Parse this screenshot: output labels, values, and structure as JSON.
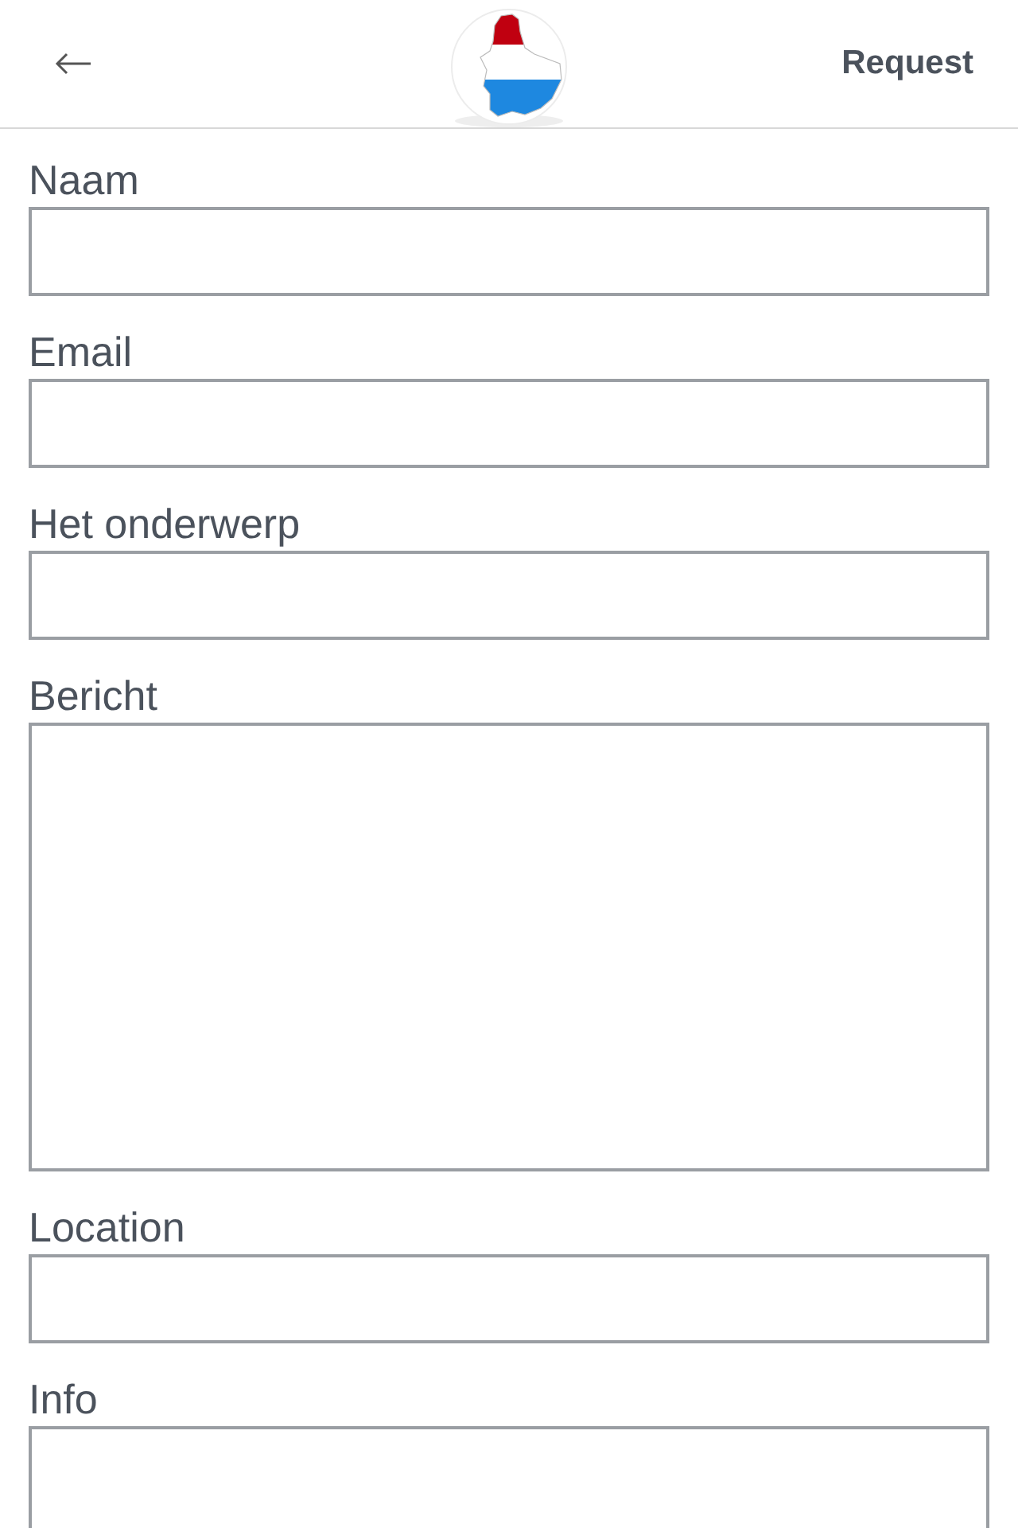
{
  "header": {
    "action": "Request"
  },
  "fields": [
    {
      "label": "Naam",
      "kind": "input"
    },
    {
      "label": "Email",
      "kind": "input"
    },
    {
      "label": "Het onderwerp",
      "kind": "input"
    },
    {
      "label": "Bericht",
      "kind": "textarea"
    },
    {
      "label": "Location",
      "kind": "input"
    },
    {
      "label": "Info",
      "kind": "textarea"
    }
  ]
}
